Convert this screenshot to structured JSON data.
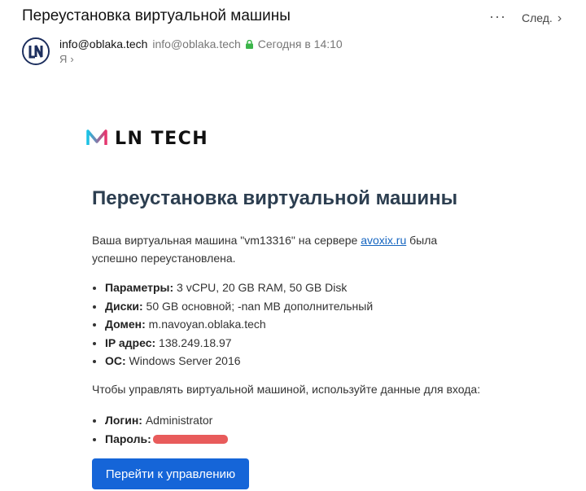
{
  "header": {
    "subject": "Переустановка виртуальной машины",
    "more_label": "···",
    "next_label": "След."
  },
  "sender": {
    "name": "info@oblaka.tech",
    "email": "info@oblaka.tech",
    "time": "Сегодня в 14:10",
    "recipient": "Я",
    "avatar_initials": "LN"
  },
  "email": {
    "logo_text": "LN TECH",
    "heading": "Переустановка виртуальной машины",
    "intro_before": "Ваша виртуальная машина \"vm13316\" на сервере ",
    "intro_link": "avoxix.ru",
    "intro_after": " была успешно переустановлена.",
    "specs": [
      {
        "label": "Параметры:",
        "value": " 3 vCPU, 20 GB RAM, 50 GB Disk"
      },
      {
        "label": "Диски:",
        "value": " 50 GB основной; -nan MB дополнительный"
      },
      {
        "label": "Домен:",
        "value": " m.navoyan.oblaka.tech"
      },
      {
        "label": "IP адрес:",
        "value": " 138.249.18.97"
      },
      {
        "label": "ОС:",
        "value": " Windows Server 2016"
      }
    ],
    "login_intro": "Чтобы управлять виртуальной машиной, используйте данные для входа:",
    "creds": [
      {
        "label": "Логин:",
        "value": " Administrator"
      },
      {
        "label": "Пароль:",
        "value": ""
      }
    ],
    "button_label": "Перейти к управлению"
  },
  "colors": {
    "accent": "#1565d8",
    "link": "#1565c0",
    "heading": "#2c3e50",
    "redaction": "#e85b5b",
    "lock": "#3bb54a"
  }
}
